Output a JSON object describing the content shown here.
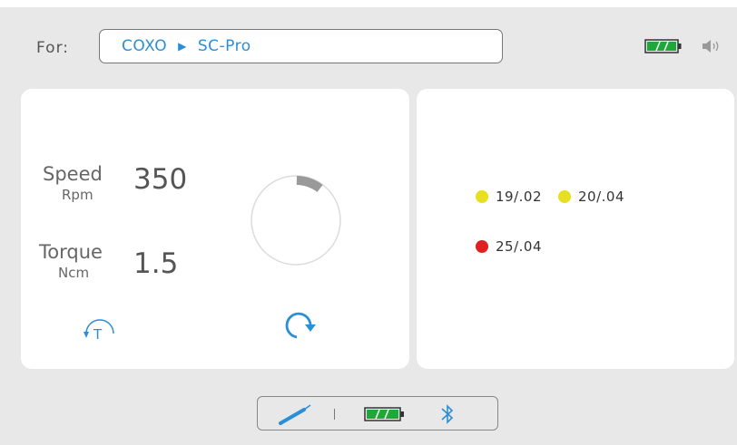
{
  "header": {
    "for_label": "For:",
    "brand": "COXO",
    "model": "SC-Pro",
    "battery_color": "#1fa83a",
    "volume_icon": "speaker-icon"
  },
  "metrics": {
    "speed_label": "Speed",
    "speed_unit": "Rpm",
    "speed_value": "350",
    "torque_label": "Torque",
    "torque_unit": "Ncm",
    "torque_value": "1.5",
    "dial_fill_fraction": 0.1
  },
  "controls": {
    "torque_icon": "torque-reverse-icon",
    "rotation_icon": "rotate-clockwise-icon",
    "accent": "#2a8fd6"
  },
  "files": [
    {
      "label": "19/.02",
      "color": "#e6e020"
    },
    {
      "label": "20/.04",
      "color": "#e6e020"
    },
    {
      "label": "25/.04",
      "color": "#e02020"
    }
  ],
  "bottom": {
    "handpiece_icon": "handpiece-icon",
    "battery_icon": "battery-icon",
    "bluetooth_icon": "bluetooth-icon"
  }
}
